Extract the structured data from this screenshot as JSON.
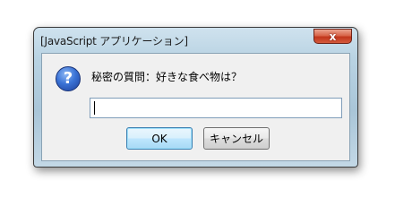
{
  "window": {
    "title": "[JavaScript アプリケーション]",
    "close_label": "x"
  },
  "dialog": {
    "icon": "question-icon",
    "message": "秘密の質問：好きな食べ物は？",
    "input_value": "",
    "ok_label": "OK",
    "cancel_label": "キャンセル"
  },
  "colors": {
    "close_button": "#c2361c",
    "focus_border": "#3c7fb1"
  }
}
